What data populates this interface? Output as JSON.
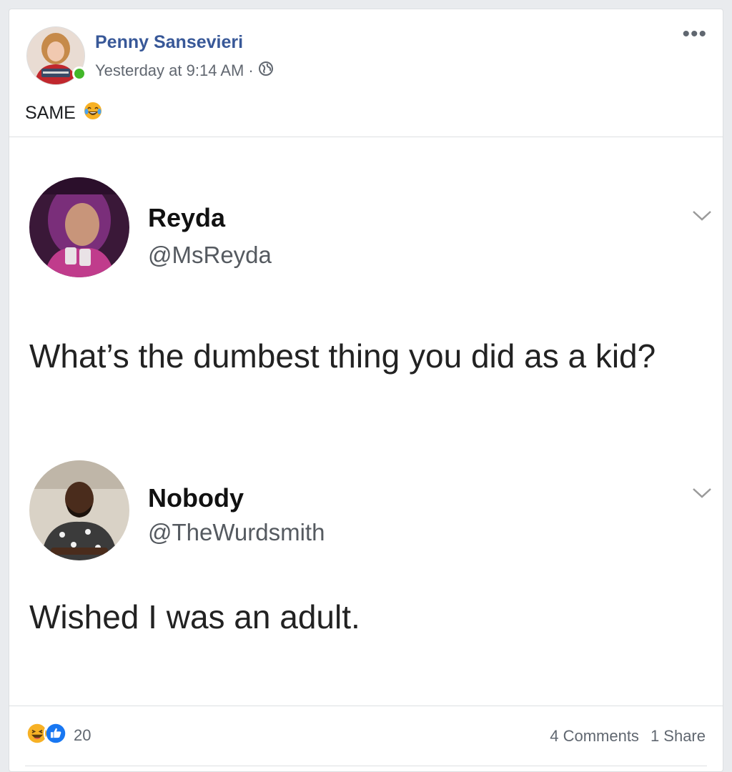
{
  "post": {
    "author": "Penny Sansevieri",
    "timestamp": "Yesterday at 9:14 AM",
    "separator": "·",
    "privacy_icon": "globe-icon",
    "text": "SAME",
    "text_emoji": "tears-of-joy-emoji"
  },
  "tweets": [
    {
      "name": "Reyda",
      "handle": "@MsReyda",
      "text": "What’s the dumbest thing you did as a kid?"
    },
    {
      "name": "Nobody",
      "handle": "@TheWurdsmith",
      "text": "Wished I was an adult."
    }
  ],
  "footer": {
    "reaction_icons": [
      "haha-icon",
      "like-icon"
    ],
    "reaction_count": "20",
    "comments": "4 Comments",
    "shares": "1 Share"
  },
  "colors": {
    "name_blue": "#385898",
    "online_green": "#42b72a",
    "like_blue": "#1877f2",
    "haha_yellow": "#f7b125"
  }
}
